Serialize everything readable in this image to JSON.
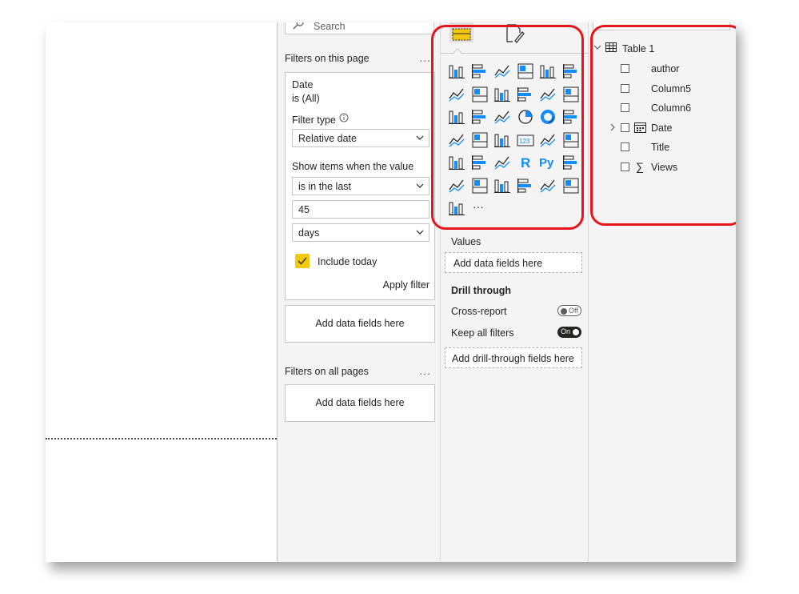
{
  "search": {
    "placeholder": "Search"
  },
  "filters": {
    "page_title": "Filters on this page",
    "more": "...",
    "card": {
      "field": "Date",
      "summary": "is (All)",
      "filter_type_label": "Filter type",
      "filter_type_value": "Relative date",
      "show_items_label": "Show items when the value",
      "operator_value": "is in the last",
      "amount_value": "45",
      "unit_value": "days",
      "include_today_label": "Include today",
      "include_today_checked": true,
      "apply_label": "Apply filter"
    },
    "add_fields_label": "Add data fields here",
    "all_pages_title": "Filters on all pages",
    "all_pages_add_label": "Add data fields here"
  },
  "visualizations": {
    "icons": [
      "stacked-bar-icon",
      "stacked-column-icon",
      "clustered-bar-icon",
      "clustered-column-icon",
      "100-bar-icon",
      "100-column-icon",
      "line-chart-icon",
      "area-chart-icon",
      "stacked-area-icon",
      "line-column-icon",
      "line-clustered-column-icon",
      "ribbon-chart-icon",
      "waterfall-icon",
      "funnel-icon",
      "scatter-icon",
      "pie-icon",
      "donut-icon",
      "treemap-icon",
      "map-icon",
      "filled-map-icon",
      "gauge-icon",
      "card-icon",
      "multi-row-card-icon",
      "kpi-icon",
      "slicer-icon",
      "table-icon",
      "matrix-icon",
      "r-visual-icon",
      "python-visual-icon",
      "key-influencers-icon",
      "decomposition-tree-icon",
      "qa-icon",
      "narrative-icon",
      "paginated-report-icon",
      "azure-map-icon",
      "power-apps-icon",
      "power-automate-icon",
      "more-visuals-icon"
    ],
    "r_label": "R",
    "py_label": "Py",
    "more_label": "···",
    "card_label": "123",
    "values_label": "Values",
    "values_add": "Add data fields here",
    "drill_title": "Drill through",
    "cross_report_label": "Cross-report",
    "cross_report_state": "Off",
    "keep_filters_label": "Keep all filters",
    "keep_filters_state": "On",
    "drill_add": "Add drill-through fields here"
  },
  "fields": {
    "table_name": "Table 1",
    "items": [
      {
        "label": "author",
        "icon": ""
      },
      {
        "label": "Column5",
        "icon": ""
      },
      {
        "label": "Column6",
        "icon": ""
      },
      {
        "label": "Date",
        "icon": "calendar-icon"
      },
      {
        "label": "Title",
        "icon": ""
      },
      {
        "label": "Views",
        "icon": "sigma-icon"
      }
    ]
  },
  "colors": {
    "highlight_ring": "#e8141b",
    "accent_yellow": "#f2c811",
    "icon_blue": "#118dff"
  }
}
